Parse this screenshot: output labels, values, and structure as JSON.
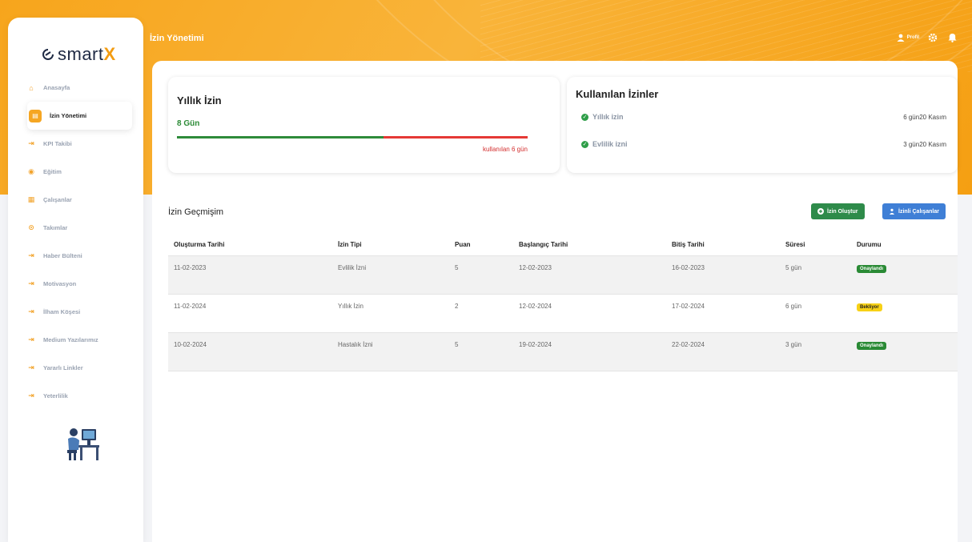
{
  "app": {
    "logo_text": "smart",
    "logo_accent": "X"
  },
  "sidebar": {
    "items": [
      {
        "label": "Anasayfa",
        "icon": "home-icon",
        "active": false
      },
      {
        "label": "İzin Yönetimi",
        "icon": "calendar-icon",
        "active": true
      },
      {
        "label": "KPI Takibi",
        "icon": "login-icon",
        "active": false
      },
      {
        "label": "Eğitim",
        "icon": "education-icon",
        "active": false
      },
      {
        "label": "Çalışanlar",
        "icon": "grid-icon",
        "active": false
      },
      {
        "label": "Takımlar",
        "icon": "team-icon",
        "active": false
      },
      {
        "label": "Haber Bülteni",
        "icon": "login-icon",
        "active": false
      },
      {
        "label": "Motivasyon",
        "icon": "login-icon",
        "active": false
      },
      {
        "label": "İlham Köşesi",
        "icon": "login-icon",
        "active": false
      },
      {
        "label": "Medium Yazılarımız",
        "icon": "login-icon",
        "active": false
      },
      {
        "label": "Yararlı Linkler",
        "icon": "login-icon",
        "active": false
      },
      {
        "label": "Yeterlilik",
        "icon": "login-icon",
        "active": false
      }
    ]
  },
  "header": {
    "title": "İzin Yönetimi",
    "profile_label": "Profil"
  },
  "annual": {
    "title": "Yıllık İzin",
    "days": "8 Gün",
    "used_label": "kullanılan 6 gün",
    "used_fraction": 0.59
  },
  "used_leaves": {
    "title": "Kullanılan İzinler",
    "items": [
      {
        "name": "Yıllık izin",
        "amount": "6 gün20 Kasım"
      },
      {
        "name": "Evlilik izni",
        "amount": "3 gün20 Kasım"
      }
    ]
  },
  "history": {
    "title": "İzin Geçmişim",
    "create_button": "İzin Oluştur",
    "leave_employees_button": "İzinli Çalışanlar",
    "columns": [
      "Oluşturma Tarihi",
      "İzin Tipi",
      "Puan",
      "Başlangıç Tarihi",
      "Bitiş Tarihi",
      "Süresi",
      "Durumu"
    ],
    "rows": [
      {
        "created": "11-02-2023",
        "type": "Evlilik İzni",
        "points": "5",
        "start": "12-02-2023",
        "end": "16-02-2023",
        "duration": "5 gün",
        "status": "Onaylandı",
        "status_kind": "ok"
      },
      {
        "created": "11-02-2024",
        "type": "Yıllık İzin",
        "points": "2",
        "start": "12-02-2024",
        "end": "17-02-2024",
        "duration": "6 gün",
        "status": "Bekliyor",
        "status_kind": "wait"
      },
      {
        "created": "10-02-2024",
        "type": "Hastalık İzni",
        "points": "5",
        "start": "19-02-2024",
        "end": "22-02-2024",
        "duration": "3 gün",
        "status": "Onaylandı",
        "status_kind": "ok"
      }
    ]
  },
  "colors": {
    "accent": "#f5a623",
    "success": "#2e8b3a",
    "danger": "#e53935",
    "primary": "#3f7fd6"
  }
}
